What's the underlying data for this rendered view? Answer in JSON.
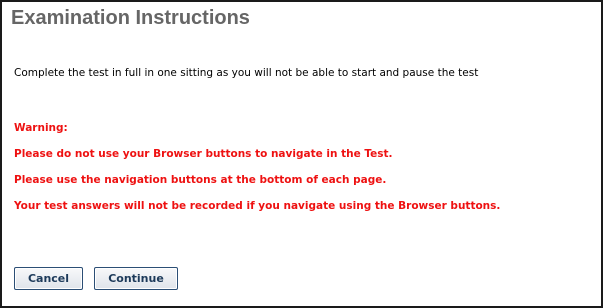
{
  "page": {
    "title": "Examination Instructions",
    "instruction": "Complete the test in full in one sitting as you will not be able to start and pause the test"
  },
  "warning": {
    "heading": "Warning:",
    "lines": [
      "Please do not use your Browser buttons to navigate in the Test.",
      "Please use the navigation buttons at the bottom of each page.",
      "Your test answers will not be recorded if you navigate using the Browser buttons."
    ]
  },
  "buttons": {
    "cancel_label": "Cancel",
    "continue_label": "Continue"
  },
  "colors": {
    "title": "#666666",
    "warning": "#ee1111",
    "button_text": "#1d3a5a",
    "frame_border": "#1a1a1a"
  }
}
